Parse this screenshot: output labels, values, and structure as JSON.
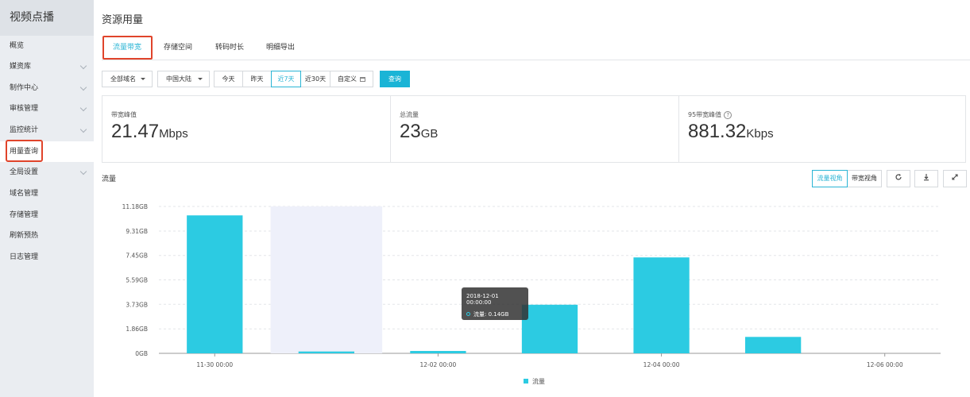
{
  "sidebar": {
    "title": "视频点播",
    "items": [
      {
        "label": "概览",
        "chevron": false,
        "active": false
      },
      {
        "label": "媒资库",
        "chevron": true,
        "active": false
      },
      {
        "label": "制作中心",
        "chevron": true,
        "active": false
      },
      {
        "label": "审核管理",
        "chevron": true,
        "active": false
      },
      {
        "label": "监控统计",
        "chevron": true,
        "active": false
      },
      {
        "label": "用量查询",
        "chevron": false,
        "active": true
      },
      {
        "label": "全局设置",
        "chevron": true,
        "active": false
      },
      {
        "label": "域名管理",
        "chevron": false,
        "active": false
      },
      {
        "label": "存储管理",
        "chevron": false,
        "active": false
      },
      {
        "label": "刷新预热",
        "chevron": false,
        "active": false
      },
      {
        "label": "日志管理",
        "chevron": false,
        "active": false
      }
    ]
  },
  "page": {
    "title": "资源用量"
  },
  "tabs": [
    {
      "label": "流量带宽",
      "active": true
    },
    {
      "label": "存储空间",
      "active": false
    },
    {
      "label": "转码时长",
      "active": false
    },
    {
      "label": "明细导出",
      "active": false
    }
  ],
  "filters": {
    "domain": "全部域名",
    "region": "中国大陆",
    "ranges": [
      {
        "label": "今天",
        "active": false
      },
      {
        "label": "昨天",
        "active": false
      },
      {
        "label": "近7天",
        "active": true
      },
      {
        "label": "近30天",
        "active": false
      },
      {
        "label": "自定义",
        "active": false
      }
    ],
    "query_label": "查询"
  },
  "stats": [
    {
      "label": "带宽峰值",
      "value": "21.47",
      "unit": "Mbps",
      "help": false
    },
    {
      "label": "总流量",
      "value": "23",
      "unit": "GB",
      "help": false
    },
    {
      "label": "95带宽峰值",
      "value": "881.32",
      "unit": "Kbps",
      "help": true
    }
  ],
  "chart_header": {
    "title": "流量",
    "views": [
      {
        "label": "流量视角",
        "active": true
      },
      {
        "label": "带宽视角",
        "active": false
      }
    ],
    "icons": [
      "refresh-icon",
      "download-icon",
      "fullscreen-icon"
    ]
  },
  "tooltip": {
    "time": "2018-12-01 00:00:00",
    "text": "流量: 0.14GB"
  },
  "colors": {
    "accent": "#2bb5d5",
    "bar": "#2ccbe2",
    "highlight": "#eef0fa",
    "red_box": "#e0442b"
  },
  "chart_data": {
    "type": "bar",
    "categories": [
      "11-30 00:00",
      "12-01 00:00",
      "12-02 00:00",
      "12-03 00:00",
      "12-04 00:00",
      "12-05 00:00",
      "12-06 00:00"
    ],
    "x_tick_labels": [
      "11-30 00:00",
      "12-02 00:00",
      "12-04 00:00",
      "12-06 00:00"
    ],
    "series": [
      {
        "name": "流量",
        "unit": "GB",
        "values": [
          10.5,
          0.14,
          0.18,
          3.7,
          7.3,
          1.25,
          0
        ]
      }
    ],
    "y_ticks": [
      "0GB",
      "1.86GB",
      "3.73GB",
      "5.59GB",
      "7.45GB",
      "9.31GB",
      "11.18GB"
    ],
    "y_tick_values": [
      0,
      1.86,
      3.73,
      5.59,
      7.45,
      9.31,
      11.18
    ],
    "ylim": [
      0,
      11.18
    ],
    "highlighted_category": "12-01 00:00",
    "grid": true,
    "legend_position": "bottom-center"
  }
}
